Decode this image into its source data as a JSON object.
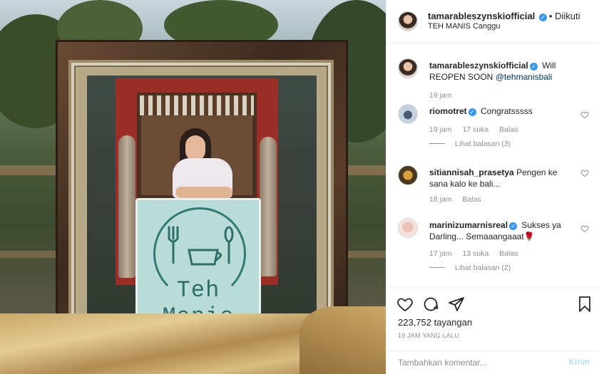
{
  "header": {
    "username": "tamarableszynskiofficial",
    "separator": "•",
    "follow_status": "Diikuti",
    "location": "TEH MANIS Canggu"
  },
  "caption": {
    "username": "tamarableszynskiofficial",
    "text": "Will REOPEN SOON",
    "mention": "@tehmanisbali",
    "time": "19 jam"
  },
  "comments": [
    {
      "username": "riomotret",
      "text": "Congratsssss",
      "time": "19 jam",
      "likes": "17 suka",
      "reply": "Balas",
      "view_replies": "Lihat balasan (3)"
    },
    {
      "username": "sitiannisah_prasetya",
      "text": "Pengen ke sana kalo ke bali...",
      "time": "18 jam",
      "reply": "Balas"
    },
    {
      "username": "marinizumarnisreal",
      "text": "Sukses ya Darling... Semaaangaaat🌹",
      "time": "17 jam",
      "likes": "13 suka",
      "reply": "Balas",
      "view_replies": "Lihat balasan (2)"
    }
  ],
  "actions": {
    "views": "223,752 tayangan",
    "posted": "19 JAM YANG LALU"
  },
  "add_comment": {
    "placeholder": "Tambahkan komentar...",
    "send_label": "Kirim"
  },
  "media": {
    "sign_text": "Teh Manis"
  },
  "colors": {
    "verified": "#3897f0",
    "link": "#00376b",
    "muted": "#8e8e8e",
    "send_disabled": "#b2dffc"
  }
}
